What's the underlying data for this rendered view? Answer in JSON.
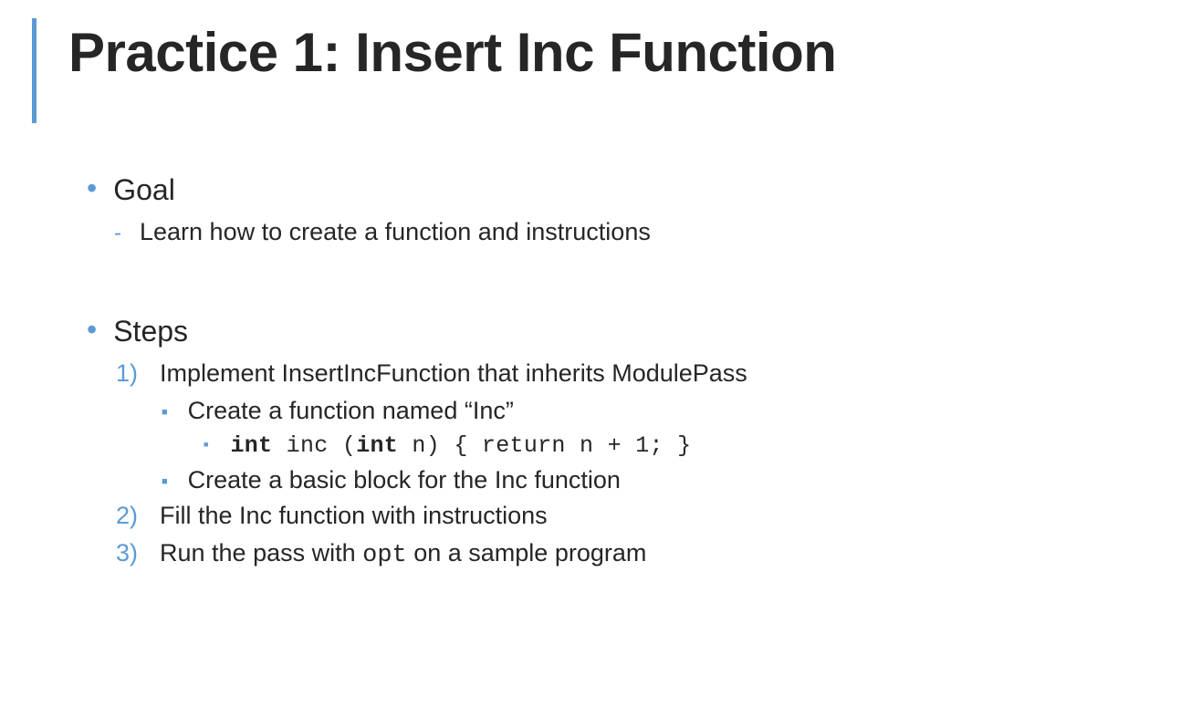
{
  "title": "Practice 1: Insert Inc Function",
  "goal": {
    "heading": "Goal",
    "item": "Learn how to create a function and instructions"
  },
  "steps": {
    "heading": "Steps",
    "items": {
      "n1": "1)",
      "t1": "Implement InsertIncFunction that inherits ModulePass",
      "s1a": "Create a function named “Inc”",
      "code_kw1": "int",
      "code_m1": " inc (",
      "code_kw2": "int",
      "code_m2": " n) { return n + 1; }",
      "s1b": "Create a basic block for the Inc function",
      "n2": "2)",
      "t2": "Fill the Inc function with instructions",
      "n3": "3)",
      "t3_pre": "Run the pass with ",
      "t3_code": "opt",
      "t3_post": " on a sample program"
    }
  }
}
